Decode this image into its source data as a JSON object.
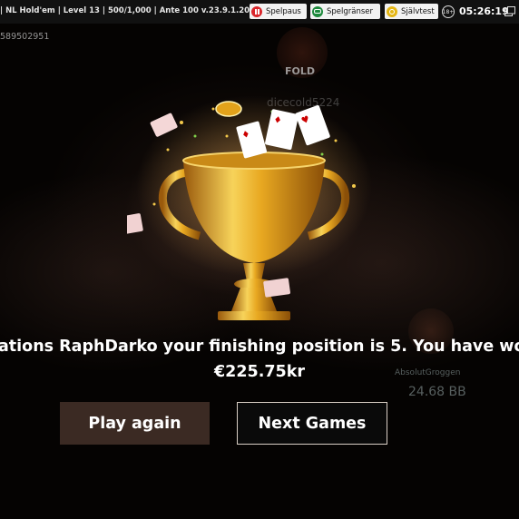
{
  "topbar": {
    "game_info": "| NL Hold'em | Level 13 | 500/1,000 | Ante 100     v.23.9.1.20",
    "buttons": [
      {
        "label": "Spelpaus",
        "icon": "pause-icon",
        "color": "#d9262b"
      },
      {
        "label": "Spelgränser",
        "icon": "limits-icon",
        "color": "#1e8a3d"
      },
      {
        "label": "Självtest",
        "icon": "self-test-icon",
        "color": "#e5b613"
      }
    ],
    "age_badge": "18+",
    "clock": "05:26:19"
  },
  "table": {
    "seat_left_id": "589502951",
    "fold_label": "FOLD",
    "player_top": "dicecold5224",
    "player_right": "AbsolutGroggen",
    "player_right_stack": "24.68 BB"
  },
  "result": {
    "message": "ations RaphDarko your finishing position is 5. You have wo",
    "prize": "€225.75kr"
  },
  "actions": {
    "play_again": "Play again",
    "next_games": "Next Games"
  },
  "colors": {
    "trophy_gold": "#e8a821",
    "play_button_bg": "#3b2a23",
    "next_button_border": "#d9cfc5"
  }
}
